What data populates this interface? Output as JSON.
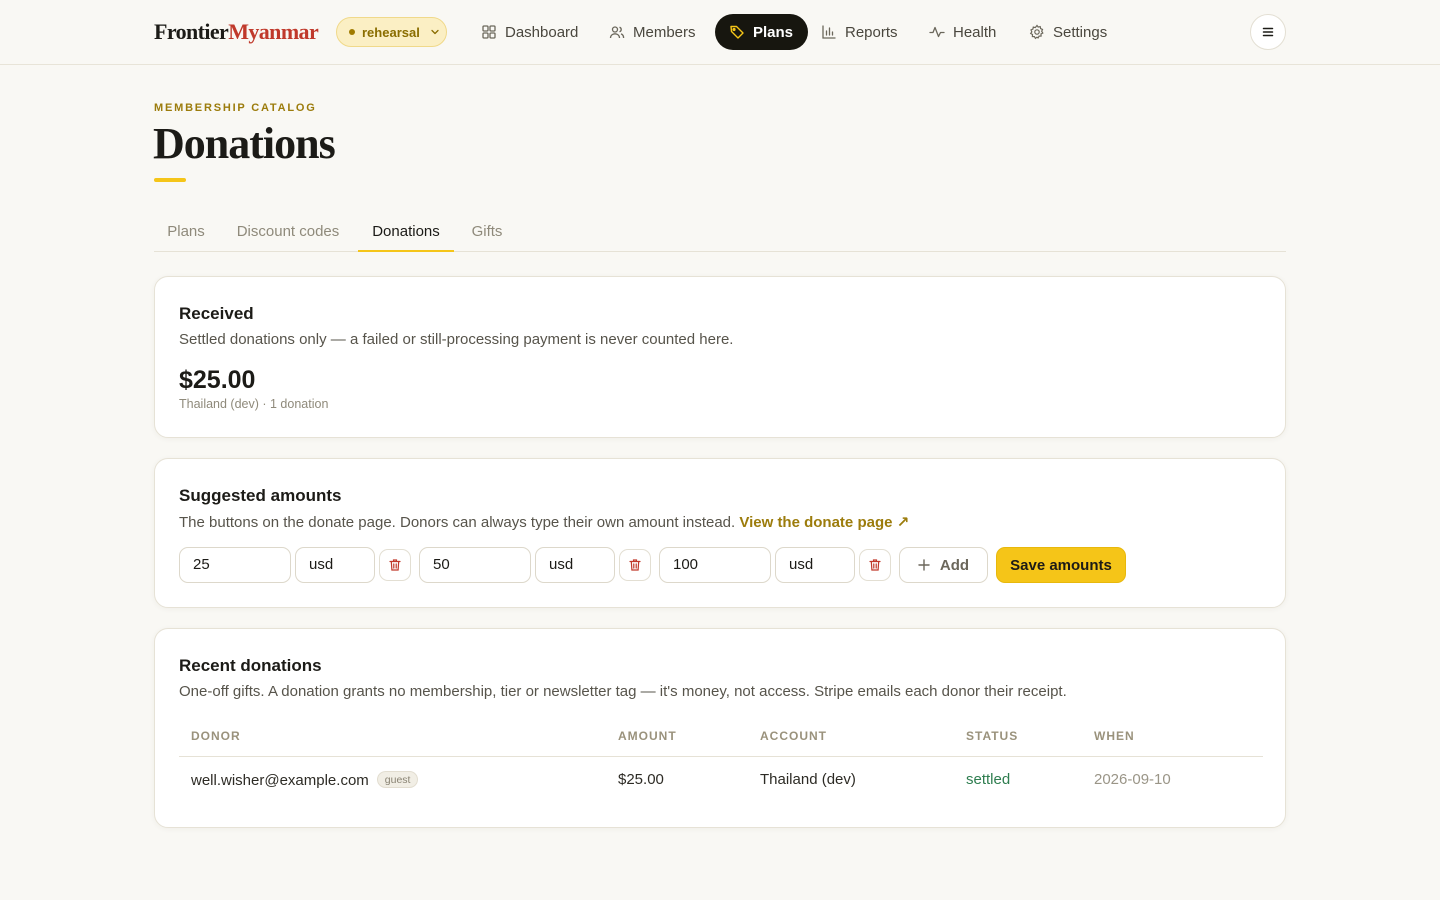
{
  "brand": {
    "part1": "Frontier",
    "part2": "Myanmar"
  },
  "environment": {
    "label": "rehearsal"
  },
  "nav": [
    {
      "label": "Dashboard",
      "icon": "grid-icon"
    },
    {
      "label": "Members",
      "icon": "users-icon"
    },
    {
      "label": "Plans",
      "icon": "tag-icon",
      "active": true
    },
    {
      "label": "Reports",
      "icon": "bar-chart-icon"
    },
    {
      "label": "Health",
      "icon": "activity-icon"
    },
    {
      "label": "Settings",
      "icon": "gear-icon"
    }
  ],
  "header": {
    "eyebrow": "MEMBERSHIP CATALOG",
    "title": "Donations"
  },
  "tabs": [
    {
      "label": "Plans"
    },
    {
      "label": "Discount codes"
    },
    {
      "label": "Donations",
      "active": true
    },
    {
      "label": "Gifts"
    }
  ],
  "received": {
    "title": "Received",
    "description": "Settled donations only — a failed or still-processing payment is never counted here.",
    "amount": "$25.00",
    "meta": "Thailand (dev) · 1 donation"
  },
  "suggested": {
    "title": "Suggested amounts",
    "description": "The buttons on the donate page. Donors can always type their own amount instead.",
    "link_label": "View the donate page ↗",
    "amounts": [
      {
        "value": "25",
        "currency": "usd"
      },
      {
        "value": "50",
        "currency": "usd"
      },
      {
        "value": "100",
        "currency": "usd"
      }
    ],
    "add_label": "Add",
    "save_label": "Save amounts"
  },
  "recent": {
    "title": "Recent donations",
    "description": "One-off gifts. A donation grants no membership, tier or newsletter tag — it's money, not access. Stripe emails each donor their receipt.",
    "columns": [
      "DONOR",
      "AMOUNT",
      "ACCOUNT",
      "STATUS",
      "WHEN"
    ],
    "rows": [
      {
        "donor": "well.wisher@example.com",
        "badge": "guest",
        "amount": "$25.00",
        "account": "Thailand (dev)",
        "status": "settled",
        "when": "2026-09-10"
      }
    ]
  },
  "colors": {
    "accent": "#f5c518",
    "brand_red": "#c0392b",
    "settled": "#2e7d4f",
    "background": "#f9f8f4"
  }
}
